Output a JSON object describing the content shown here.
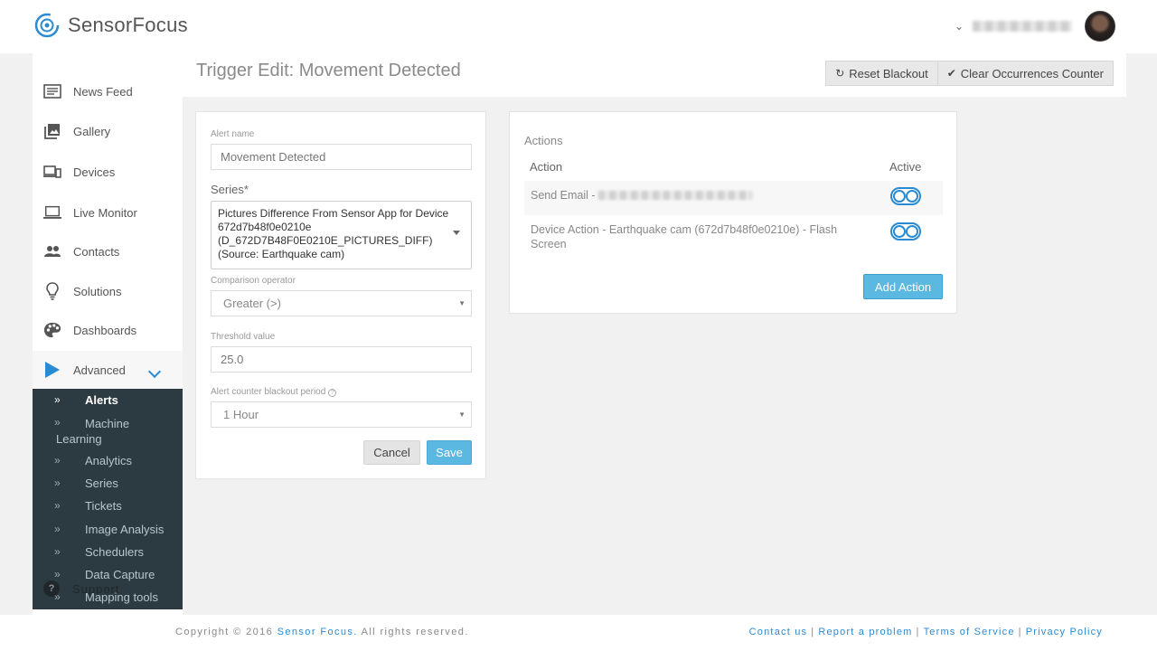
{
  "header": {
    "brand": "SensorFocus"
  },
  "sidebar": {
    "items": [
      {
        "label": "News Feed",
        "icon": "news-feed-icon"
      },
      {
        "label": "Gallery",
        "icon": "gallery-icon"
      },
      {
        "label": "Devices",
        "icon": "devices-icon"
      },
      {
        "label": "Live Monitor",
        "icon": "monitor-icon"
      },
      {
        "label": "Contacts",
        "icon": "contacts-icon"
      },
      {
        "label": "Solutions",
        "icon": "lightbulb-icon"
      },
      {
        "label": "Dashboards",
        "icon": "palette-icon"
      },
      {
        "label": "Advanced",
        "icon": "play-icon"
      }
    ],
    "submenu": [
      {
        "label": "Alerts",
        "active": true
      },
      {
        "label": "Machine Learning"
      },
      {
        "label": "Analytics"
      },
      {
        "label": "Series"
      },
      {
        "label": "Tickets"
      },
      {
        "label": "Image Analysis"
      },
      {
        "label": "Schedulers"
      },
      {
        "label": "Data Capture"
      },
      {
        "label": "Mapping tools"
      }
    ],
    "support_label": "Support"
  },
  "page": {
    "title": "Trigger Edit: Movement Detected",
    "reset_blackout_label": "Reset Blackout",
    "clear_counter_label": "Clear Occurrences Counter"
  },
  "form": {
    "alert_name_label": "Alert name",
    "alert_name_value": "Movement Detected",
    "series_label": "Series*",
    "series_value": "Pictures Difference From Sensor App for Device 672d7b48f0e0210e (D_672D7B48F0E0210E_PICTURES_DIFF) (Source: Earthquake cam)",
    "comparison_label": "Comparison operator",
    "comparison_value": "Greater (>)",
    "threshold_label": "Threshold value",
    "threshold_value": "25.0",
    "blackout_label": "Alert counter blackout period",
    "blackout_value": "1 Hour",
    "cancel_label": "Cancel",
    "save_label": "Save"
  },
  "actions": {
    "title": "Actions",
    "col_action": "Action",
    "col_active": "Active",
    "rows": [
      {
        "text": "Send Email - ",
        "active": true
      },
      {
        "text": "Device Action - Earthquake cam (672d7b48f0e0210e) - Flash Screen",
        "active": true
      }
    ],
    "add_label": "Add Action"
  },
  "footer": {
    "copyright_prefix": "Copyright © 2016 ",
    "copyright_brand": "Sensor Focus.",
    "copyright_suffix": " All rights reserved.",
    "links": [
      "Contact us",
      "Report a problem",
      "Terms of Service",
      "Privacy Policy"
    ]
  },
  "colors": {
    "accent": "#2a8bd2",
    "button_primary": "#5bb8e0",
    "submenu_bg": "#2c3a42"
  }
}
